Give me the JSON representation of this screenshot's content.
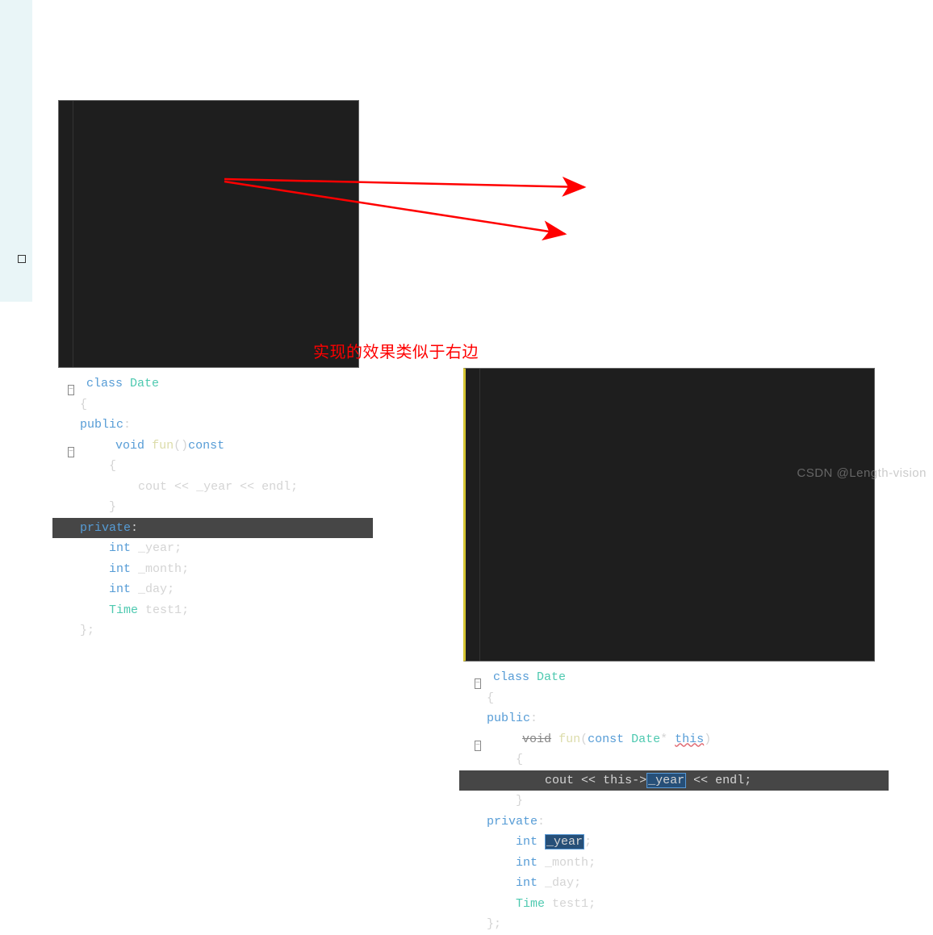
{
  "left": {
    "l0_class": "class",
    "l0_name": "Date",
    "l1": "{",
    "l2_pub": "public",
    "l2_c": ":",
    "l3_void": "void",
    "l3_fun": "fun",
    "l3_par": "()",
    "l3_const": "const",
    "l4": "{",
    "l5_cout": "cout",
    "l5_op1": "<<",
    "l5_y": "_year",
    "l5_op2": "<<",
    "l5_endl": "endl",
    "l5_sc": ";",
    "l6": "}",
    "l7_priv": "private",
    "l7_c": ":",
    "l8_int": "int",
    "l8_y": "_year",
    "l8_sc": ";",
    "l9_int": "int",
    "l9_m": "_month",
    "l9_sc": ";",
    "l10_int": "int",
    "l10_d": "_day",
    "l10_sc": ";",
    "l11_t": "Time",
    "l11_v": "test1",
    "l11_sc": ";",
    "l12": "};"
  },
  "right": {
    "l0_class": "class",
    "l0_name": "Date",
    "l1": "{",
    "l2_pub": "public",
    "l2_c": ":",
    "l3_void": "void",
    "l3_fun": "fun",
    "l3_lp": "(",
    "l3_const": "const",
    "l3_dt": "Date",
    "l3_star": "*",
    "l3_this": "this",
    "l3_rp": ")",
    "l4": "{",
    "l5_cout": "cout",
    "l5_op1": "<<",
    "l5_this": "this",
    "l5_arrow": "->",
    "l5_y": "_year",
    "l5_op2": "<<",
    "l5_endl": "endl",
    "l5_sc": ";",
    "l6": "}",
    "l7_priv": "private",
    "l7_c": ":",
    "l8_int": "int",
    "l8_y": "_year",
    "l8_sc": ";",
    "l9_int": "int",
    "l9_m": "_month",
    "l9_sc": ";",
    "l10_int": "int",
    "l10_d": "_day",
    "l10_sc": ";",
    "l11_t": "Time",
    "l11_v": "test1",
    "l11_sc": ";",
    "l12": "};"
  },
  "annotation": "实现的效果类似于右边",
  "watermark": "CSDN @Length-vision",
  "fold_glyph": "−"
}
